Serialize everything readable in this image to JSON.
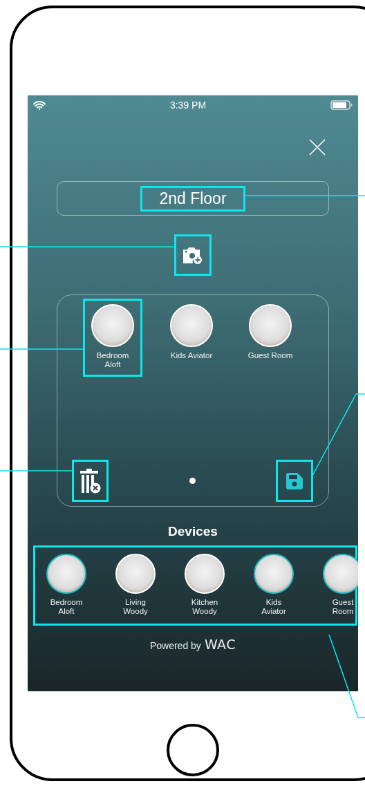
{
  "status_bar": {
    "time": "3:39 PM"
  },
  "group": {
    "name": "2nd Floor",
    "callout": true,
    "devices": [
      {
        "name": "Bedroom Aloft",
        "callout": true
      },
      {
        "name": "Kids Aviator",
        "callout": false
      },
      {
        "name": "Guest Room",
        "callout": false
      }
    ],
    "page_dots": [
      {
        "selected": true
      }
    ]
  },
  "camera_button": {
    "callout": true
  },
  "delete_button": {
    "callout": true
  },
  "save_button": {
    "callout": true
  },
  "devices": {
    "title": "Devices",
    "callout": true,
    "items": [
      {
        "name": "Bedroom Aloft",
        "selected": true
      },
      {
        "name": "Living Woody",
        "selected": false
      },
      {
        "name": "Kitchen Woody",
        "selected": false
      },
      {
        "name": "Kids Aviator",
        "selected": true
      },
      {
        "name": "Guest Room",
        "selected": true
      }
    ]
  },
  "footer": {
    "powered_by": "Powered by",
    "brand": "WAC"
  }
}
